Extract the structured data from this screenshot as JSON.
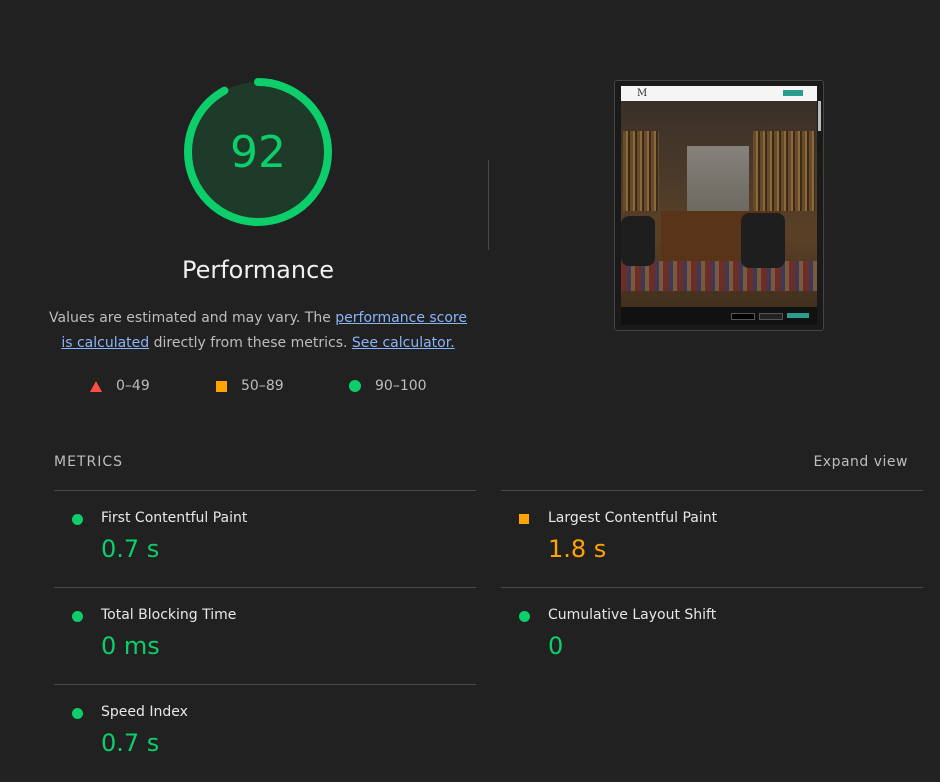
{
  "score": {
    "value": "92",
    "fraction": 0.92,
    "title": "Performance",
    "color": "#0cce6b"
  },
  "description": {
    "text_1": "Values are estimated and may vary. The ",
    "link_1": "performance score is calculated",
    "text_2": " directly from these metrics. ",
    "link_2": "See calculator."
  },
  "legend": [
    {
      "range": "0–49",
      "shape": "triangle-icon",
      "color": "#ff4e42"
    },
    {
      "range": "50–89",
      "shape": "square-icon",
      "color": "#ffa400"
    },
    {
      "range": "90–100",
      "shape": "circle-icon",
      "color": "#0cce6b"
    }
  ],
  "metrics": {
    "header": "METRICS",
    "expand_label": "Expand view",
    "items": [
      {
        "label": "First Contentful Paint",
        "value": "0.7 s",
        "status": "good"
      },
      {
        "label": "Largest Contentful Paint",
        "value": "1.8 s",
        "status": "average"
      },
      {
        "label": "Total Blocking Time",
        "value": "0 ms",
        "status": "good"
      },
      {
        "label": "Cumulative Layout Shift",
        "value": "0",
        "status": "good"
      },
      {
        "label": "Speed Index",
        "value": "0.7 s",
        "status": "good"
      }
    ]
  },
  "thumbnail": {
    "logo": "M"
  }
}
